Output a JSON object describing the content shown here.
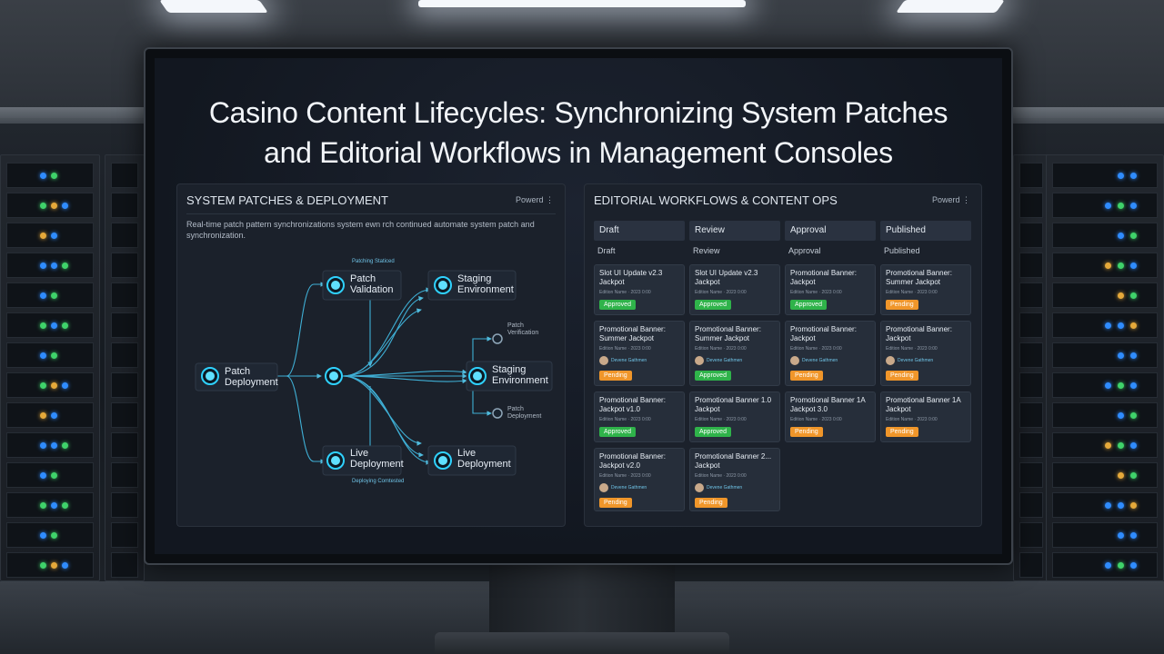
{
  "colors": {
    "approved": "#2fb34a",
    "pending": "#f0962a",
    "accent": "#22c6f0"
  },
  "title_line1": "Casino Content Lifecycles: Synchronizing System Patches",
  "title_line2": "and Editorial Workflows in Management Consoles",
  "left_panel": {
    "title": "SYSTEM PATCHES & DEPLOYMENT",
    "menu": "Powerd ⋮",
    "desc": "Real-time patch pattern synchronizations system ewn rch continued automate system patch and synchronization.",
    "nodes": {
      "patch_deployment": "Patch Deployment",
      "patch_validation": "Patch Validation",
      "patch_validation_caption": "Patching Staticed",
      "staging_top": "Staging Environment",
      "staging_mid": "Staging Environment",
      "live_bottom": "Live Deployment",
      "live_bottom_caption": "Deploying Comtested",
      "live_right": "Live Deployment",
      "small_top": "Patch Verification",
      "small_bottom": "Patch Deployment"
    }
  },
  "right_panel": {
    "title": "EDITORIAL WORKFLOWS & CONTENT OPS",
    "menu": "Powerd ⋮",
    "columns": [
      {
        "head": "Draft",
        "sub": "Draft"
      },
      {
        "head": "Review",
        "sub": "Review"
      },
      {
        "head": "Approval",
        "sub": "Approval"
      },
      {
        "head": "Published",
        "sub": "Published"
      }
    ],
    "cards": {
      "c0r0": {
        "title": "Slot UI Update v2.3 Jackpot",
        "meta": "Edition Name · 2023 0:00",
        "badge": "Approved"
      },
      "c0r1": {
        "title": "Promotional Banner: Summer Jackpot",
        "meta": "Edition Name · 2023 0:00",
        "user": "Devene Gathmen",
        "badge": "Pending"
      },
      "c0r2": {
        "title": "Promotional Banner: Jackpot v1.0",
        "meta": "Edition Name · 2023 0:00",
        "badge": "Approved"
      },
      "c0r3": {
        "title": "Promotional Banner: Jackpot v2.0",
        "meta": "Edition Name · 2023 0:00",
        "user": "Devene Gathmen",
        "badge": "Pending"
      },
      "c1r0": {
        "title": "Slot UI Update v2.3 Jackpot",
        "meta": "Edition Name · 2023 0:00",
        "badge": "Approved"
      },
      "c1r1": {
        "title": "Promotional Banner: Summer Jackpot",
        "meta": "Edition Name · 2023 0:00",
        "user": "Devene Gathmen",
        "badge": "Approved"
      },
      "c1r2": {
        "title": "Promotional Banner 1.0 Jackpot",
        "meta": "Edition Name · 2023 0:00",
        "badge": "Approved"
      },
      "c1r3": {
        "title": "Promotional Banner 2... Jackpot",
        "meta": "Edition Name · 2023 0:00",
        "user": "Devene Gathmen",
        "badge": "Pending"
      },
      "c2r0": {
        "title": "Promotional Banner: Jackpot",
        "meta": "Edition Name · 2023 0:00",
        "badge": "Approved"
      },
      "c2r1": {
        "title": "Promotional Banner: Jackpot",
        "meta": "Edition Name · 2023 0:00",
        "user": "Devene Gathmen",
        "badge": "Pending"
      },
      "c2r2": {
        "title": "Promotional Banner 1A Jackpot 3.0",
        "meta": "Edition Name · 2023 0:00",
        "badge": "Pending"
      },
      "c3r0": {
        "title": "Promotional Banner: Summer Jackpot",
        "meta": "Edition Name · 2023 0:00",
        "badge": "Pending"
      },
      "c3r1": {
        "title": "Promotional Banner: Jackpot",
        "meta": "Edition Name · 2023 0:00",
        "user": "Devene Gathmen",
        "badge": "Pending"
      },
      "c3r2": {
        "title": "Promotional Banner 1A Jackpot",
        "meta": "Edition Name · 2023 0:00",
        "badge": "Pending"
      }
    }
  }
}
